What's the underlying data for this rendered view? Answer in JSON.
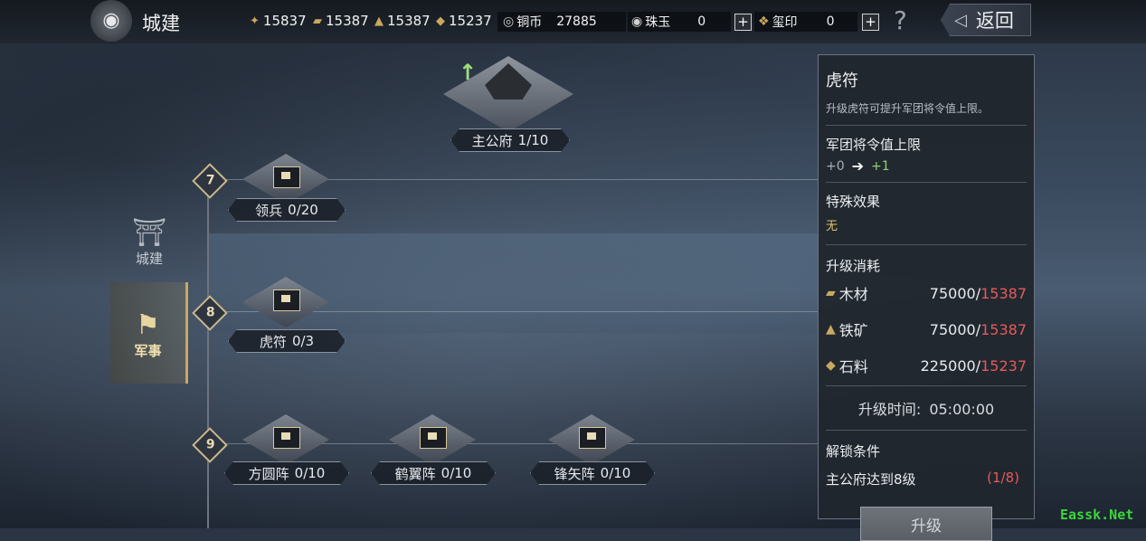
{
  "header": {
    "title": "城建",
    "resources": [
      {
        "icon": "wheat-icon",
        "value": "15837"
      },
      {
        "icon": "wood-icon",
        "value": "15387"
      },
      {
        "icon": "iron-icon",
        "value": "15387"
      },
      {
        "icon": "stone-icon",
        "value": "15237"
      }
    ],
    "copper": {
      "label": "铜币",
      "value": "27885"
    },
    "jade": {
      "label": "珠玉",
      "value": "0"
    },
    "seal": {
      "label": "玺印",
      "value": "0"
    },
    "help": "?",
    "back_label": "返回"
  },
  "sidenav": [
    {
      "label": "城建",
      "icon": "palace-icon",
      "active": false
    },
    {
      "label": "军事",
      "icon": "war-flag-icon",
      "active": true
    }
  ],
  "tree": {
    "main": {
      "name": "主公府",
      "level": "1/10"
    },
    "tiers": [
      {
        "tier": "7",
        "buildings": [
          {
            "name": "领兵",
            "level": "0/20"
          }
        ]
      },
      {
        "tier": "8",
        "buildings": [
          {
            "name": "虎符",
            "level": "0/3"
          }
        ]
      },
      {
        "tier": "9",
        "buildings": [
          {
            "name": "方圆阵",
            "level": "0/10"
          },
          {
            "name": "鹤翼阵",
            "level": "0/10"
          },
          {
            "name": "锋矢阵",
            "level": "0/10"
          }
        ]
      }
    ]
  },
  "panel": {
    "title": "虎符",
    "description": "升级虎符可提升军团将令值上限。",
    "stat_label": "军团将令值上限",
    "stat_current": "+0",
    "stat_next": "+1",
    "special_label": "特殊效果",
    "special_value": "无",
    "cost_label": "升级消耗",
    "costs": [
      {
        "name": "木材",
        "need": "75000/",
        "have": "15387"
      },
      {
        "name": "铁矿",
        "need": "75000/",
        "have": "15387"
      },
      {
        "name": "石料",
        "need": "225000/",
        "have": "15237"
      }
    ],
    "time_label": "升级时间:",
    "time_value": "05:00:00",
    "unlock_label": "解锁条件",
    "unlock_condition": "主公府达到8级",
    "unlock_progress": "(1/8)",
    "upgrade_button": "升级"
  },
  "watermark": "Eassk.Net"
}
